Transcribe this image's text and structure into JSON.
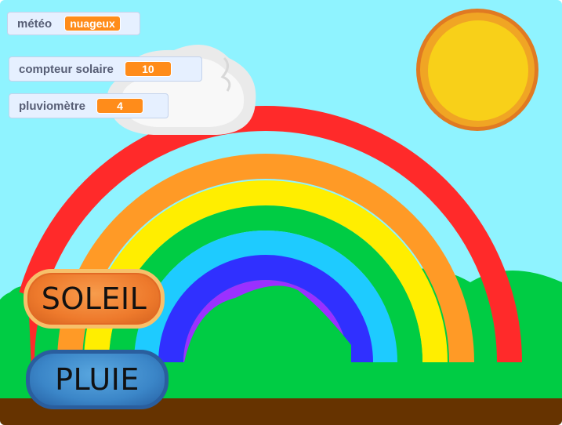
{
  "monitors": {
    "meteo": {
      "label": "météo",
      "value": "nuageux"
    },
    "compteur_solaire": {
      "label": "compteur solaire",
      "value": "10"
    },
    "pluviometre": {
      "label": "pluviomètre",
      "value": "4"
    }
  },
  "buttons": {
    "soleil": "SOLEIL",
    "pluie": "PLUIE"
  },
  "colors": {
    "sky": "#8ff3ff",
    "monitor_value": "#ff8c1a",
    "grass": "#00cc44",
    "ground": "#663300",
    "rainbow": [
      "#ff2a2a",
      "#ff9a26",
      "#ffee00",
      "#00cc44",
      "#1ecbff",
      "#3030ff",
      "#9b30ff"
    ]
  }
}
